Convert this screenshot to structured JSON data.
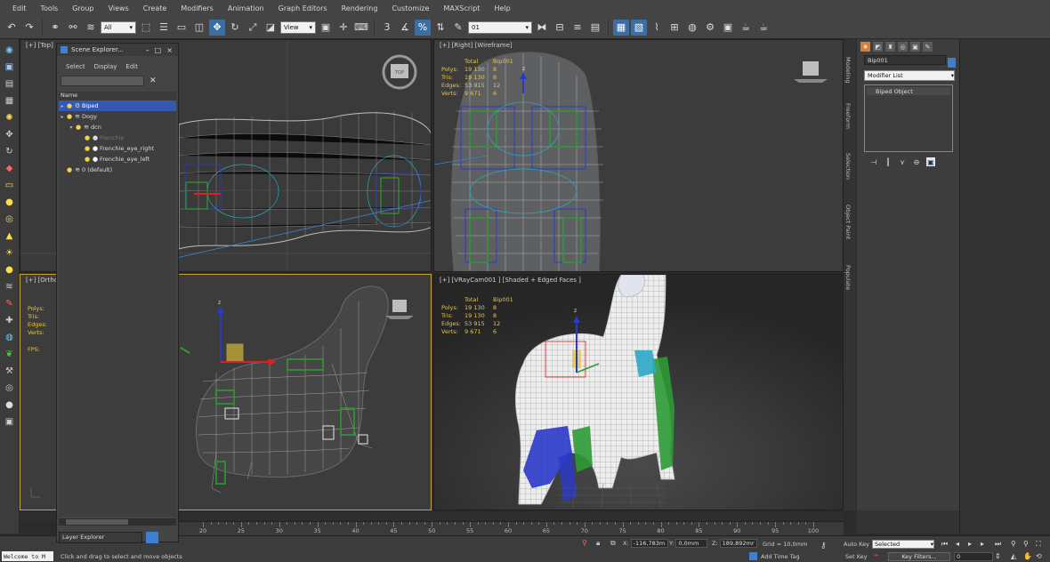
{
  "menu": [
    "Edit",
    "Tools",
    "Group",
    "Views",
    "Create",
    "Modifiers",
    "Animation",
    "Graph Editors",
    "Rendering",
    "Customize",
    "MAXScript",
    "Help"
  ],
  "toolbar": {
    "filter_value": "All",
    "refcoord_value": "View",
    "selset_value": "01",
    "angle_snap_label": "3",
    "icons": [
      "undo-icon",
      "redo-icon",
      "link-icon",
      "unlink-icon",
      "bind-spacewarp-icon",
      "select-object-icon",
      "select-by-name-icon",
      "rect-region-icon",
      "window-crossing-icon",
      "move-icon",
      "rotate-icon",
      "scale-icon",
      "pivot-icon",
      "snap-toggle-icon",
      "angle-snap-icon",
      "percent-snap-icon",
      "spinner-snap-icon",
      "mirror-icon",
      "align-icon",
      "layer-manager-icon",
      "ribbon-icon",
      "curve-editor-icon",
      "schematic-icon",
      "material-editor-icon",
      "render-setup-icon",
      "rendered-frame-icon",
      "render-icon"
    ]
  },
  "scene_explorer": {
    "title": "Scene Explorer...",
    "menus": [
      "Select",
      "Display",
      "Edit"
    ],
    "column_header": "Name",
    "rows": [
      {
        "label": "Biped",
        "selected": true,
        "dim": false
      },
      {
        "label": "Dogy",
        "selected": false,
        "dim": false
      },
      {
        "label": "dcn",
        "selected": false,
        "dim": false
      },
      {
        "label": "Frenchie",
        "selected": false,
        "dim": true
      },
      {
        "label": "Frenchie_eye_right",
        "selected": false,
        "dim": false
      },
      {
        "label": "Frenchie_eye_left",
        "selected": false,
        "dim": false
      },
      {
        "label": "0 (default)",
        "selected": false,
        "dim": false
      }
    ],
    "bottom_dropdown": "Layer Explorer"
  },
  "viewports": {
    "top": {
      "label": "[+] [Top]"
    },
    "right": {
      "label": "[+] [Right] [Wireframe]",
      "stats": {
        "total_label": "Total",
        "obj_label": "Bip001",
        "rows": [
          {
            "k": "Polys:",
            "v": "19 130",
            "o": "8"
          },
          {
            "k": "Tris:",
            "v": "19 130",
            "o": "8"
          },
          {
            "k": "Edges:",
            "v": "53 915",
            "o": "12"
          },
          {
            "k": "Verts:",
            "v": "9 671",
            "o": "6"
          }
        ]
      }
    },
    "ortho": {
      "label": "[+] [Ortho",
      "stats_labels": [
        "Polys:",
        "Tris:",
        "Edges:",
        "Verts:"
      ],
      "fps_label": "FPS:"
    },
    "cam": {
      "label": "[+] [VRayCam001 ] [Shaded + Edged Faces ]",
      "stats": {
        "total_label": "Total",
        "obj_label": "Bip001",
        "rows": [
          {
            "k": "Polys:",
            "v": "19 130",
            "o": "8"
          },
          {
            "k": "Tris:",
            "v": "19 130",
            "o": "8"
          },
          {
            "k": "Edges:",
            "v": "53 915",
            "o": "12"
          },
          {
            "k": "Verts:",
            "v": "9 671",
            "o": "6"
          }
        ]
      }
    },
    "viewcube_label": "TOP",
    "axis_z": "z"
  },
  "command_panel": {
    "object_name": "Bip001",
    "modifier_list": "Modifier List",
    "stack_item": "Biped Object",
    "side_tabs": [
      "Modeling",
      "Freeform",
      "Selection",
      "Object Paint",
      "Populate"
    ]
  },
  "timeline": {
    "ticks": [
      20,
      25,
      30,
      35,
      40,
      45,
      50,
      55,
      60,
      65,
      70,
      75,
      80,
      85,
      90,
      95,
      100
    ]
  },
  "statusbar": {
    "welcome": "Welcome to M",
    "prompt": "Click and drag to select and move objects",
    "x_label": "X:",
    "x_value": "-116,783m",
    "y_label": "Y:",
    "y_value": "0,0mm",
    "z_label": "Z:",
    "z_value": "189,892mr",
    "grid": "Grid = 10,0mm",
    "add_time_tag": "Add Time Tag",
    "auto_key": "Auto Key",
    "set_key": "Set Key",
    "selected": "Selected",
    "key_filters": "Key Filters...",
    "frame": "0"
  },
  "colors": {
    "accent_blue": "#3558b0",
    "selection_yellow": "#c7a43a",
    "biped_green": "#2e9a34",
    "biped_blue": "#2a39c8",
    "biped_cyan": "#2aa8c4"
  }
}
